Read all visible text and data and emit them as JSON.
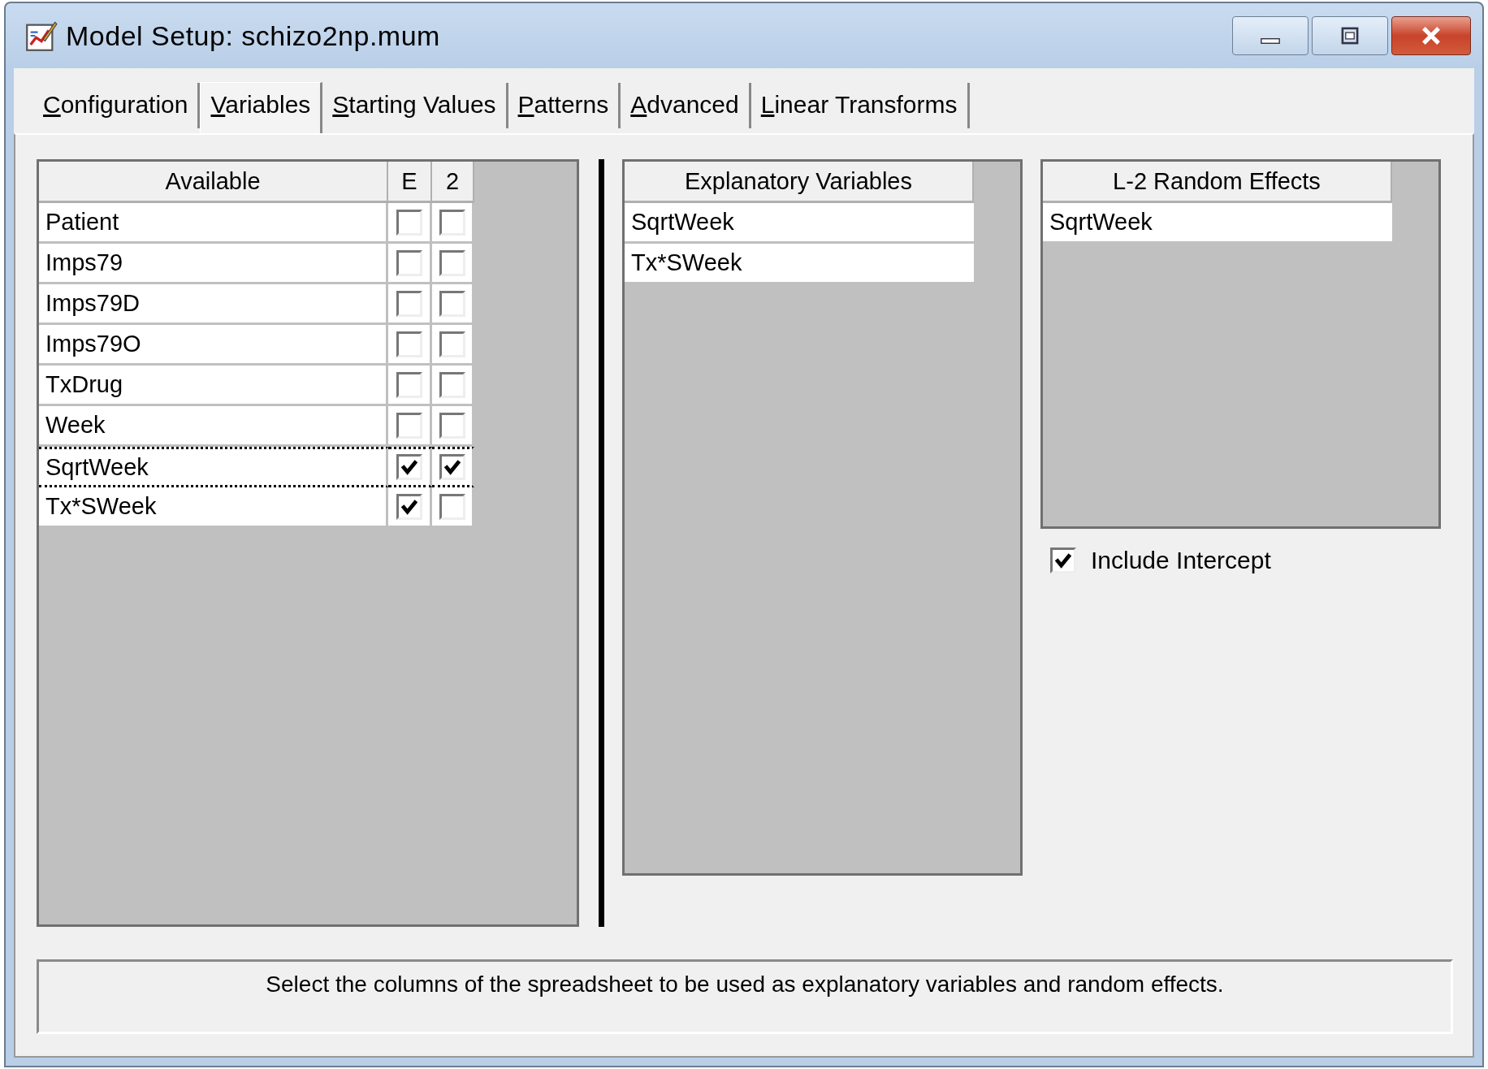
{
  "window": {
    "title": "Model Setup: schizo2np.mum"
  },
  "tabs": [
    {
      "label": "Configuration",
      "selected": false
    },
    {
      "label": "Variables",
      "selected": true
    },
    {
      "label": "Starting Values",
      "selected": false
    },
    {
      "label": "Patterns",
      "selected": false
    },
    {
      "label": "Advanced",
      "selected": false
    },
    {
      "label": "Linear Transforms",
      "selected": false
    }
  ],
  "available": {
    "columns": [
      "Available",
      "E",
      "2"
    ],
    "rows": [
      {
        "name": "Patient",
        "e": false,
        "l2": false,
        "focused": false
      },
      {
        "name": "Imps79",
        "e": false,
        "l2": false,
        "focused": false
      },
      {
        "name": "Imps79D",
        "e": false,
        "l2": false,
        "focused": false
      },
      {
        "name": "Imps79O",
        "e": false,
        "l2": false,
        "focused": false
      },
      {
        "name": "TxDrug",
        "e": false,
        "l2": false,
        "focused": false
      },
      {
        "name": "Week",
        "e": false,
        "l2": false,
        "focused": false
      },
      {
        "name": "SqrtWeek",
        "e": true,
        "l2": true,
        "focused": true
      },
      {
        "name": "Tx*SWeek",
        "e": true,
        "l2": false,
        "focused": false
      }
    ]
  },
  "explanatory": {
    "column": "Explanatory Variables",
    "rows": [
      "SqrtWeek",
      "Tx*SWeek"
    ]
  },
  "random_effects": {
    "column": "L-2 Random Effects",
    "rows": [
      "SqrtWeek"
    ]
  },
  "include_intercept": {
    "label": "Include Intercept",
    "checked": true
  },
  "status": "Select the columns of the spreadsheet to be used as explanatory variables and random effects."
}
